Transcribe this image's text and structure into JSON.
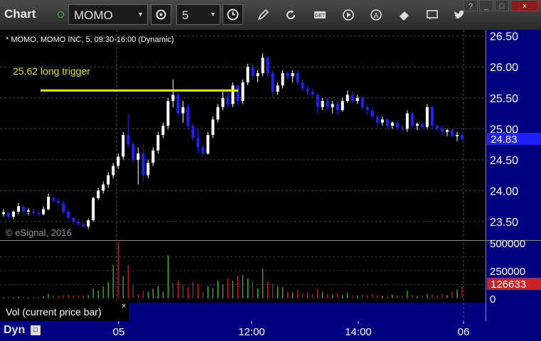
{
  "toolbar": {
    "title": "Chart",
    "symbol": "MOMO",
    "interval": "5",
    "icons": [
      "gear-icon",
      "clock-icon",
      "pencil-icon",
      "refresh-icon",
      "get-icon",
      "play-icon",
      "a-icon",
      "eraser-icon",
      "comment-icon",
      "twitter-icon"
    ],
    "window_buttons": [
      "?",
      "_",
      "□",
      "×"
    ]
  },
  "chart": {
    "info": "* MOMO, MOMO INC, 5, 09:30-16:00 (Dynamic)",
    "annotation": "25.62 long trigger",
    "copyright": "© eSignal, 2016",
    "current_price": "24.83",
    "current_volume": "126633",
    "vol_label": "Vol (current price bar)",
    "dyn_label": "Dyn"
  },
  "colors": {
    "up": "#ffffff",
    "down": "#1f1fff",
    "vol_up": "#33cc33",
    "vol_down": "#cc2222",
    "axis_bg": "#000080",
    "trigger": "#e6e600"
  },
  "chart_data": {
    "type": "candlestick",
    "y_ticks": [
      "26.50",
      "26.00",
      "25.50",
      "25.00",
      "24.50",
      "24.00",
      "23.50"
    ],
    "volume_ticks": [
      "500000",
      "250000",
      "0"
    ],
    "x_ticks": [
      "05",
      "12:00",
      "14:00",
      "06"
    ],
    "trigger_price": 25.62,
    "ylim": [
      23.2,
      26.6
    ],
    "volume_max": 500000,
    "candles": [
      [
        23.62,
        23.7,
        23.58,
        23.65
      ],
      [
        23.64,
        23.66,
        23.55,
        23.58
      ],
      [
        23.58,
        23.68,
        23.54,
        23.66
      ],
      [
        23.66,
        23.8,
        23.62,
        23.75
      ],
      [
        23.74,
        23.78,
        23.62,
        23.66
      ],
      [
        23.66,
        23.72,
        23.6,
        23.68
      ],
      [
        23.66,
        23.72,
        23.6,
        23.64
      ],
      [
        23.64,
        23.68,
        23.58,
        23.62
      ],
      [
        23.62,
        23.75,
        23.6,
        23.7
      ],
      [
        23.7,
        23.95,
        23.68,
        23.9
      ],
      [
        23.88,
        23.92,
        23.8,
        23.84
      ],
      [
        23.84,
        23.88,
        23.76,
        23.8
      ],
      [
        23.8,
        23.84,
        23.62,
        23.66
      ],
      [
        23.66,
        23.7,
        23.52,
        23.56
      ],
      [
        23.56,
        23.58,
        23.45,
        23.5
      ],
      [
        23.5,
        23.54,
        23.42,
        23.46
      ],
      [
        23.46,
        23.5,
        23.38,
        23.42
      ],
      [
        23.42,
        23.55,
        23.38,
        23.52
      ],
      [
        23.52,
        23.9,
        23.5,
        23.88
      ],
      [
        23.88,
        24.05,
        23.85,
        24.0
      ],
      [
        24.0,
        24.15,
        23.95,
        24.1
      ],
      [
        24.1,
        24.3,
        24.05,
        24.25
      ],
      [
        24.25,
        24.45,
        24.2,
        24.4
      ],
      [
        24.4,
        24.6,
        24.35,
        24.55
      ],
      [
        24.55,
        24.95,
        24.5,
        24.9
      ],
      [
        24.9,
        25.25,
        24.7,
        24.75
      ],
      [
        24.75,
        24.8,
        24.45,
        24.5
      ],
      [
        24.5,
        24.7,
        24.1,
        24.6
      ],
      [
        24.6,
        24.75,
        24.15,
        24.25
      ],
      [
        24.25,
        24.5,
        24.2,
        24.45
      ],
      [
        24.45,
        24.7,
        24.4,
        24.65
      ],
      [
        24.65,
        24.95,
        24.6,
        24.9
      ],
      [
        24.9,
        25.1,
        24.85,
        25.05
      ],
      [
        25.05,
        25.5,
        25.0,
        25.45
      ],
      [
        25.45,
        25.8,
        25.35,
        25.55
      ],
      [
        25.55,
        25.6,
        25.2,
        25.25
      ],
      [
        25.25,
        25.45,
        25.1,
        25.35
      ],
      [
        25.35,
        25.4,
        25.0,
        25.05
      ],
      [
        25.05,
        25.1,
        24.8,
        24.85
      ],
      [
        24.85,
        25.0,
        24.6,
        24.7
      ],
      [
        24.7,
        24.75,
        24.55,
        24.6
      ],
      [
        24.6,
        24.95,
        24.58,
        24.9
      ],
      [
        24.9,
        25.2,
        24.85,
        25.15
      ],
      [
        25.15,
        25.4,
        25.1,
        25.35
      ],
      [
        25.35,
        25.6,
        25.3,
        25.5
      ],
      [
        25.5,
        25.6,
        25.35,
        25.4
      ],
      [
        25.4,
        25.75,
        25.35,
        25.7
      ],
      [
        25.7,
        25.72,
        25.4,
        25.45
      ],
      [
        25.45,
        25.8,
        25.4,
        25.75
      ],
      [
        25.75,
        26.05,
        25.7,
        26.0
      ],
      [
        26.0,
        26.05,
        25.8,
        25.85
      ],
      [
        25.85,
        25.95,
        25.75,
        25.9
      ],
      [
        25.9,
        26.22,
        25.85,
        26.15
      ],
      [
        26.15,
        26.18,
        25.85,
        25.9
      ],
      [
        25.9,
        25.95,
        25.5,
        25.6
      ],
      [
        25.6,
        25.75,
        25.55,
        25.7
      ],
      [
        25.7,
        25.95,
        25.65,
        25.9
      ],
      [
        25.9,
        25.93,
        25.8,
        25.85
      ],
      [
        25.85,
        25.95,
        25.75,
        25.9
      ],
      [
        25.9,
        25.95,
        25.7,
        25.75
      ],
      [
        25.75,
        25.8,
        25.6,
        25.65
      ],
      [
        25.65,
        25.7,
        25.55,
        25.6
      ],
      [
        25.6,
        25.65,
        25.5,
        25.55
      ],
      [
        25.55,
        25.58,
        25.25,
        25.35
      ],
      [
        25.35,
        25.5,
        25.3,
        25.45
      ],
      [
        25.45,
        25.5,
        25.3,
        25.35
      ],
      [
        25.35,
        25.45,
        25.25,
        25.4
      ],
      [
        25.4,
        25.45,
        25.22,
        25.3
      ],
      [
        25.3,
        25.5,
        25.28,
        25.45
      ],
      [
        25.45,
        25.62,
        25.42,
        25.55
      ],
      [
        25.55,
        25.6,
        25.4,
        25.45
      ],
      [
        25.45,
        25.55,
        25.4,
        25.5
      ],
      [
        25.5,
        25.55,
        25.3,
        25.35
      ],
      [
        25.35,
        25.4,
        25.22,
        25.3
      ],
      [
        25.3,
        25.35,
        25.15,
        25.2
      ],
      [
        25.2,
        25.25,
        25.05,
        25.1
      ],
      [
        25.1,
        25.2,
        25.05,
        25.15
      ],
      [
        25.15,
        25.18,
        25.0,
        25.05
      ],
      [
        25.05,
        25.12,
        25.0,
        25.1
      ],
      [
        25.1,
        25.12,
        24.98,
        25.02
      ],
      [
        25.02,
        25.08,
        24.95,
        25.0
      ],
      [
        25.0,
        25.3,
        24.95,
        25.25
      ],
      [
        25.25,
        25.28,
        25.02,
        25.05
      ],
      [
        25.05,
        25.1,
        24.98,
        25.08
      ],
      [
        25.08,
        25.12,
        25.0,
        25.03
      ],
      [
        25.03,
        25.4,
        25.0,
        25.35
      ],
      [
        25.35,
        25.38,
        25.0,
        25.05
      ],
      [
        25.05,
        25.08,
        24.95,
        25.0
      ],
      [
        25.0,
        25.05,
        24.9,
        24.95
      ],
      [
        24.95,
        25.0,
        24.88,
        24.98
      ],
      [
        24.98,
        25.0,
        24.85,
        24.88
      ],
      [
        24.88,
        24.95,
        24.8,
        24.9
      ],
      [
        24.9,
        24.95,
        24.78,
        24.83
      ]
    ],
    "volumes": [
      [
        12000,
        "up"
      ],
      [
        15000,
        "down"
      ],
      [
        10000,
        "up"
      ],
      [
        18000,
        "up"
      ],
      [
        14000,
        "down"
      ],
      [
        9000,
        "up"
      ],
      [
        11000,
        "down"
      ],
      [
        13000,
        "down"
      ],
      [
        20000,
        "up"
      ],
      [
        40000,
        "up"
      ],
      [
        25000,
        "down"
      ],
      [
        22000,
        "down"
      ],
      [
        30000,
        "down"
      ],
      [
        35000,
        "down"
      ],
      [
        28000,
        "down"
      ],
      [
        24000,
        "down"
      ],
      [
        26000,
        "down"
      ],
      [
        30000,
        "up"
      ],
      [
        90000,
        "up"
      ],
      [
        70000,
        "up"
      ],
      [
        110000,
        "up"
      ],
      [
        150000,
        "up"
      ],
      [
        300000,
        "up"
      ],
      [
        510000,
        "down"
      ],
      [
        200000,
        "up"
      ],
      [
        300000,
        "down"
      ],
      [
        120000,
        "down"
      ],
      [
        40000,
        "down"
      ],
      [
        70000,
        "down"
      ],
      [
        60000,
        "up"
      ],
      [
        90000,
        "up"
      ],
      [
        110000,
        "up"
      ],
      [
        60000,
        "up"
      ],
      [
        390000,
        "up"
      ],
      [
        140000,
        "down"
      ],
      [
        160000,
        "down"
      ],
      [
        120000,
        "down"
      ],
      [
        100000,
        "down"
      ],
      [
        150000,
        "down"
      ],
      [
        130000,
        "down"
      ],
      [
        60000,
        "down"
      ],
      [
        110000,
        "up"
      ],
      [
        90000,
        "up"
      ],
      [
        160000,
        "up"
      ],
      [
        120000,
        "up"
      ],
      [
        180000,
        "down"
      ],
      [
        160000,
        "up"
      ],
      [
        200000,
        "down"
      ],
      [
        210000,
        "up"
      ],
      [
        180000,
        "up"
      ],
      [
        150000,
        "down"
      ],
      [
        90000,
        "up"
      ],
      [
        270000,
        "up"
      ],
      [
        150000,
        "down"
      ],
      [
        130000,
        "down"
      ],
      [
        110000,
        "up"
      ],
      [
        100000,
        "up"
      ],
      [
        60000,
        "down"
      ],
      [
        55000,
        "up"
      ],
      [
        75000,
        "down"
      ],
      [
        45000,
        "down"
      ],
      [
        50000,
        "down"
      ],
      [
        40000,
        "down"
      ],
      [
        85000,
        "down"
      ],
      [
        60000,
        "up"
      ],
      [
        40000,
        "down"
      ],
      [
        35000,
        "up"
      ],
      [
        45000,
        "down"
      ],
      [
        30000,
        "up"
      ],
      [
        50000,
        "up"
      ],
      [
        30000,
        "down"
      ],
      [
        25000,
        "up"
      ],
      [
        35000,
        "down"
      ],
      [
        28000,
        "down"
      ],
      [
        40000,
        "down"
      ],
      [
        30000,
        "down"
      ],
      [
        25000,
        "up"
      ],
      [
        22000,
        "down"
      ],
      [
        35000,
        "up"
      ],
      [
        30000,
        "down"
      ],
      [
        25000,
        "down"
      ],
      [
        70000,
        "up"
      ],
      [
        30000,
        "down"
      ],
      [
        20000,
        "up"
      ],
      [
        25000,
        "down"
      ],
      [
        40000,
        "up"
      ],
      [
        35000,
        "down"
      ],
      [
        28000,
        "down"
      ],
      [
        40000,
        "down"
      ],
      [
        30000,
        "up"
      ],
      [
        60000,
        "down"
      ],
      [
        80000,
        "up"
      ],
      [
        110000,
        "down"
      ]
    ]
  }
}
